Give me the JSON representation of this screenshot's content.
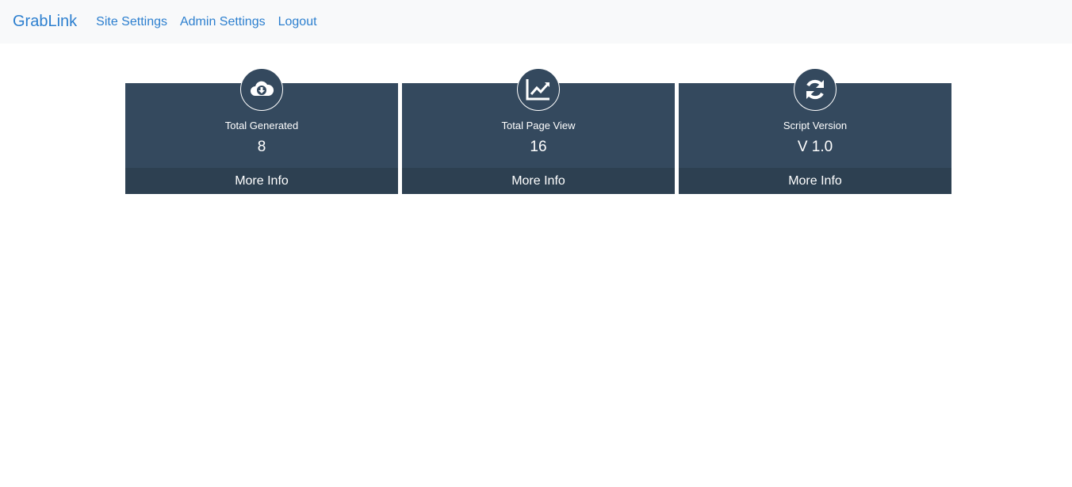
{
  "nav": {
    "brand": "GrabLink",
    "links": [
      "Site Settings",
      "Admin Settings",
      "Logout"
    ]
  },
  "cards": [
    {
      "icon": "cloud-download-icon",
      "label": "Total Generated",
      "value": "8",
      "footer": "More Info"
    },
    {
      "icon": "line-chart-icon",
      "label": "Total Page View",
      "value": "16",
      "footer": "More Info"
    },
    {
      "icon": "refresh-icon",
      "label": "Script Version",
      "value": "V 1.0",
      "footer": "More Info"
    }
  ],
  "colors": {
    "link": "#2c7fcf",
    "card": "#34495e",
    "card_footer": "#2d4051",
    "navbar": "#f8f9fa"
  }
}
